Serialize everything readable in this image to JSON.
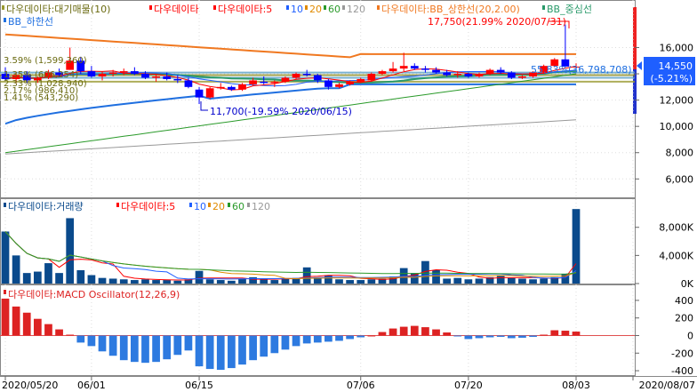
{
  "colors": {
    "up": "#ff0000",
    "down": "#0000ff",
    "volume": "#0a4a8c",
    "macd_pos": "#dd2222",
    "macd_neg": "#2d7ae0",
    "ma5": "#ff0000",
    "ma10": "#1f5fff",
    "ma20": "#e08a00",
    "ma60": "#2a9a2a",
    "ma120": "#999999",
    "bb_upper": "#f07820",
    "bb_mid": "#2a9a6a",
    "bb_lower": "#1f6fe0",
    "supply": "#9a9a30",
    "frame": "#888888",
    "grid": "#dddddd"
  },
  "price_panel": {
    "legend": {
      "supply": "다우데이타:대기매물(10)",
      "price": "다우데이타",
      "ma_prefix": "다우데이타:5",
      "ma10": "10",
      "ma20": "20",
      "ma60": "60",
      "ma120": "120",
      "bb_upper": "다우데이타:BB_상한선(20,2.00)",
      "bb_mid": "BB_중심선",
      "bb_lower": "BB_하한선"
    },
    "annot_high": "17,750(21.99% 2020/07/31)",
    "annot_low": "11,700(-19.59% 2020/06/15)",
    "annot_current": "55.83%(36,798,708)",
    "supply_labels": [
      "3.59% (1,599,360)",
      "1.41% (543,290)",
      "1.35% (606,254)",
      "2.33% (1,028,940)",
      "2.17% (986,410)"
    ],
    "current_price": "14,550",
    "current_change": "(-5.21%)",
    "y_ticks": [
      {
        "value": 16000,
        "label": "16,000"
      },
      {
        "value": 14000,
        "label": "14,000"
      },
      {
        "value": 12000,
        "label": "12,000"
      },
      {
        "value": 10000,
        "label": "10,000"
      },
      {
        "value": 8000,
        "label": "8,000"
      },
      {
        "value": 6000,
        "label": "6,000"
      }
    ]
  },
  "volume_panel": {
    "legend": {
      "volume": "다우데이타:거래량",
      "ma_prefix": "다우데이타:5",
      "ma10": "10",
      "ma20": "20",
      "ma60": "60",
      "ma120": "120"
    },
    "y_ticks": [
      {
        "value": 8000000,
        "label": "8,000K"
      },
      {
        "value": 4000000,
        "label": "4,000K"
      },
      {
        "value": 0,
        "label": "0K"
      }
    ]
  },
  "macd_panel": {
    "legend": "다우데이타:MACD Oscillator(12,26,9)",
    "y_ticks": [
      {
        "value": 400,
        "label": "400"
      },
      {
        "value": 200,
        "label": "200"
      },
      {
        "value": 0,
        "label": "0"
      },
      {
        "value": -200,
        "label": "-200"
      },
      {
        "value": -400,
        "label": "-400"
      }
    ]
  },
  "x_axis": [
    {
      "index": 0,
      "label": "2020/05/20"
    },
    {
      "index": 8,
      "label": "06/01"
    },
    {
      "index": 18,
      "label": "06/15"
    },
    {
      "index": 33,
      "label": "07/06"
    },
    {
      "index": 43,
      "label": "07/20"
    },
    {
      "index": 53,
      "label": "08/03"
    },
    {
      "index": 57,
      "label": "2020/08/07"
    }
  ],
  "chart_data": {
    "type": "candlestick",
    "dates": [
      "05/20",
      "05/21",
      "05/22",
      "05/25",
      "05/26",
      "05/27",
      "05/28",
      "05/29",
      "06/01",
      "06/02",
      "06/03",
      "06/04",
      "06/05",
      "06/08",
      "06/09",
      "06/10",
      "06/11",
      "06/12",
      "06/15",
      "06/16",
      "06/17",
      "06/18",
      "06/19",
      "06/22",
      "06/23",
      "06/24",
      "06/25",
      "06/26",
      "06/29",
      "06/30",
      "07/01",
      "07/02",
      "07/03",
      "07/06",
      "07/07",
      "07/08",
      "07/09",
      "07/10",
      "07/13",
      "07/14",
      "07/15",
      "07/16",
      "07/17",
      "07/20",
      "07/21",
      "07/22",
      "07/23",
      "07/24",
      "07/27",
      "07/28",
      "07/29",
      "07/30",
      "07/31",
      "08/03"
    ],
    "ohlc": [
      [
        14000,
        14500,
        13500,
        13600
      ],
      [
        13600,
        14100,
        13300,
        13900
      ],
      [
        13900,
        14200,
        13300,
        13500
      ],
      [
        13500,
        13800,
        13300,
        13700
      ],
      [
        13700,
        14300,
        13600,
        14100
      ],
      [
        14100,
        14400,
        13800,
        13900
      ],
      [
        14300,
        16000,
        14300,
        15000
      ],
      [
        15000,
        15300,
        14000,
        14200
      ],
      [
        14200,
        14600,
        13700,
        13800
      ],
      [
        13800,
        14200,
        13500,
        14000
      ],
      [
        14000,
        14300,
        13800,
        14100
      ],
      [
        14100,
        14400,
        13900,
        14200
      ],
      [
        14200,
        14500,
        13900,
        14000
      ],
      [
        14000,
        14200,
        13600,
        13700
      ],
      [
        13700,
        14000,
        13400,
        13800
      ],
      [
        13800,
        14100,
        13500,
        13600
      ],
      [
        13600,
        13900,
        13300,
        13500
      ],
      [
        13500,
        13700,
        12900,
        13000
      ],
      [
        12800,
        13000,
        11700,
        12200
      ],
      [
        12200,
        13000,
        12100,
        12900
      ],
      [
        12900,
        13300,
        12800,
        13000
      ],
      [
        13000,
        13100,
        12700,
        12800
      ],
      [
        12800,
        13300,
        12700,
        13200
      ],
      [
        13200,
        13700,
        13100,
        13500
      ],
      [
        13400,
        13800,
        13200,
        13300
      ],
      [
        13300,
        13500,
        13000,
        13400
      ],
      [
        13400,
        13800,
        13300,
        13700
      ],
      [
        13700,
        14100,
        13600,
        14000
      ],
      [
        14000,
        14300,
        13800,
        13900
      ],
      [
        13900,
        14000,
        13300,
        13500
      ],
      [
        13500,
        13600,
        12800,
        13000
      ],
      [
        13000,
        13300,
        12900,
        13200
      ],
      [
        13200,
        13500,
        13100,
        13400
      ],
      [
        13400,
        13700,
        13300,
        13600
      ],
      [
        13500,
        14100,
        13400,
        14000
      ],
      [
        14000,
        14300,
        13900,
        14200
      ],
      [
        14200,
        14900,
        14100,
        14400
      ],
      [
        14400,
        15600,
        14200,
        14600
      ],
      [
        14600,
        14800,
        14300,
        14400
      ],
      [
        14400,
        14600,
        14100,
        14300
      ],
      [
        14300,
        14500,
        14000,
        14100
      ],
      [
        14100,
        14300,
        13800,
        13900
      ],
      [
        13900,
        14200,
        13700,
        14000
      ],
      [
        14000,
        14100,
        13700,
        13800
      ],
      [
        13800,
        14100,
        13700,
        14000
      ],
      [
        14000,
        14400,
        13900,
        14300
      ],
      [
        14300,
        14500,
        14000,
        14100
      ],
      [
        14100,
        14200,
        13600,
        13700
      ],
      [
        13700,
        13900,
        13600,
        13800
      ],
      [
        13800,
        14200,
        13700,
        14100
      ],
      [
        14100,
        14700,
        14000,
        14600
      ],
      [
        14600,
        15200,
        14500,
        15100
      ],
      [
        15100,
        17750,
        14500,
        14550
      ],
      [
        14550,
        14800,
        14400,
        14550
      ]
    ],
    "volume": [
      7400000,
      4000000,
      1500000,
      1700000,
      2900000,
      1500000,
      9300000,
      1900000,
      1200000,
      800000,
      700000,
      600000,
      500000,
      600000,
      500000,
      500000,
      400000,
      600000,
      1800000,
      600000,
      500000,
      400000,
      700000,
      900000,
      600000,
      500000,
      700000,
      800000,
      2300000,
      900000,
      1200000,
      600000,
      500000,
      500000,
      600000,
      700000,
      1000000,
      2200000,
      1500000,
      3200000,
      1900000,
      700000,
      800000,
      600000,
      700000,
      900000,
      1200000,
      800000,
      700000,
      600000,
      700000,
      900000,
      1400000,
      10600000
    ],
    "macd_osc": [
      420,
      330,
      260,
      190,
      130,
      70,
      10,
      -80,
      -120,
      -180,
      -230,
      -280,
      -300,
      -310,
      -300,
      -270,
      -220,
      -170,
      -350,
      -380,
      -390,
      -370,
      -330,
      -280,
      -240,
      -200,
      -160,
      -120,
      -90,
      -80,
      -70,
      -60,
      -40,
      -20,
      0,
      40,
      80,
      100,
      110,
      95,
      70,
      35,
      -10,
      -40,
      -30,
      -20,
      -15,
      -30,
      -25,
      -15,
      10,
      60,
      55,
      45
    ],
    "ma_values": {
      "bb_upper_range": [
        17000,
        15200
      ],
      "bb_lower_range": [
        10200,
        13200
      ],
      "ma120_range": [
        7900,
        10500
      ],
      "ma60_range": [
        8000,
        14000
      ]
    },
    "price_ylim": [
      4600,
      18400
    ],
    "volume_ylim": [
      0,
      11000000
    ],
    "macd_ylim": [
      -450,
      480
    ]
  }
}
